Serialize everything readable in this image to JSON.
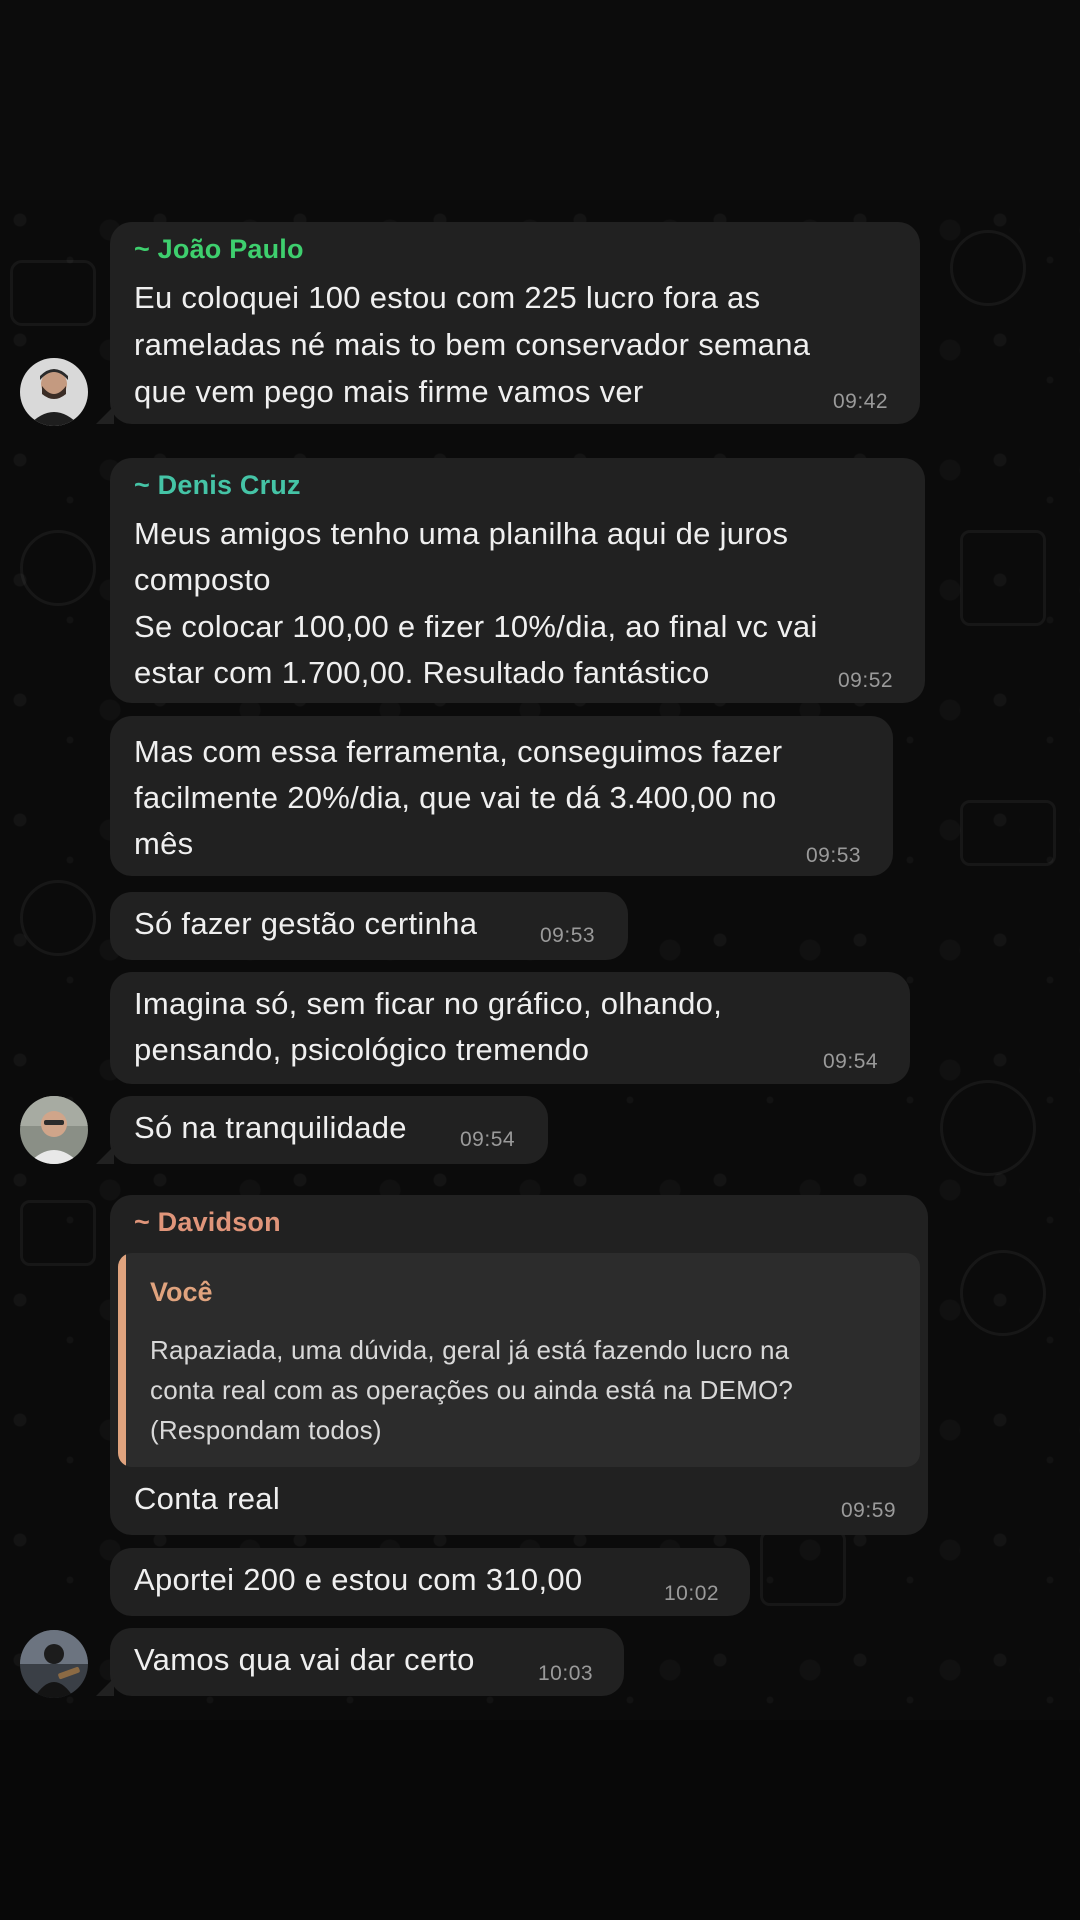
{
  "messages": [
    {
      "sender": "~ João Paulo",
      "sender_color": "#3ecf6e",
      "lines": [
        "Eu coloquei 100 estou com 225 lucro fora as",
        "rameladas né mais to bem conservador semana",
        "que vem pego mais firme vamos ver"
      ],
      "time": "09:42"
    },
    {
      "sender": "~ Denis Cruz",
      "sender_color": "#45c4a6",
      "lines": [
        "Meus amigos tenho uma planilha aqui de juros",
        "composto",
        "Se colocar 100,00 e fizer 10%/dia, ao final vc vai",
        "estar com 1.700,00. Resultado fantástico"
      ],
      "time": "09:52"
    },
    {
      "lines": [
        "Mas com essa ferramenta, conseguimos fazer",
        "facilmente 20%/dia, que vai te dá 3.400,00 no",
        "mês"
      ],
      "time": "09:53"
    },
    {
      "lines": [
        "Só fazer gestão certinha"
      ],
      "time": "09:53"
    },
    {
      "lines": [
        "Imagina só, sem ficar no gráfico, olhando,",
        "pensando, psicológico tremendo"
      ],
      "time": "09:54"
    },
    {
      "lines": [
        "Só na tranquilidade"
      ],
      "time": "09:54"
    },
    {
      "sender": "~ Davidson",
      "sender_color": "#e0957a",
      "quote": {
        "author": "Você",
        "lines": [
          "Rapaziada, uma dúvida, geral já está fazendo lucro na",
          "conta real com as operações ou ainda está na DEMO?",
          "(Respondam todos)"
        ]
      },
      "lines": [
        "Conta real"
      ],
      "time": "09:59"
    },
    {
      "lines": [
        "Aportei 200 e estou com 310,00"
      ],
      "time": "10:02"
    },
    {
      "lines": [
        "Vamos qua vai dar certo"
      ],
      "time": "10:03"
    }
  ],
  "colors": {
    "bubble": "#212121",
    "background": "#0b0b0b",
    "quote_accent": "#e0a37e"
  }
}
